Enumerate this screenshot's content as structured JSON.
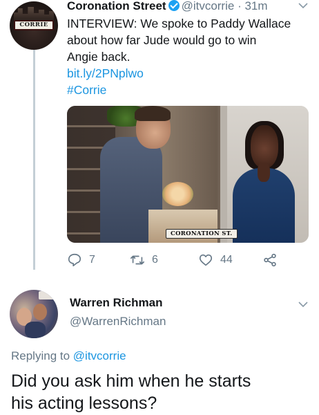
{
  "tweet1": {
    "avatar_sign": "CORRIE",
    "name": "Coronation Street",
    "handle": "@itvcorrie",
    "time": "· 31m",
    "text_lines": [
      "INTERVIEW: We spoke to Paddy Wallace",
      "about how far Jude would go to win",
      "Angie back."
    ],
    "link": "bit.ly/2PNplwo",
    "hashtag": "#Corrie",
    "media_badge": "CORONATION ST.",
    "actions": {
      "reply_count": "7",
      "retweet_count": "6",
      "like_count": "44"
    }
  },
  "tweet2": {
    "name": "Warren Richman",
    "handle": "@WarrenRichman",
    "replying_prefix": "Replying to",
    "replying_to": "@itvcorrie",
    "text_lines": [
      "Did you ask him when he starts",
      "his acting lessons?"
    ]
  },
  "colors": {
    "link_blue": "#1b95e0",
    "verified_blue": "#1da1f2",
    "muted_gray": "#657786",
    "thread_line": "#c4cfd6"
  },
  "icons": [
    "reply-icon",
    "retweet-icon",
    "like-icon",
    "share-icon",
    "verified-icon",
    "chevron-down-icon"
  ]
}
